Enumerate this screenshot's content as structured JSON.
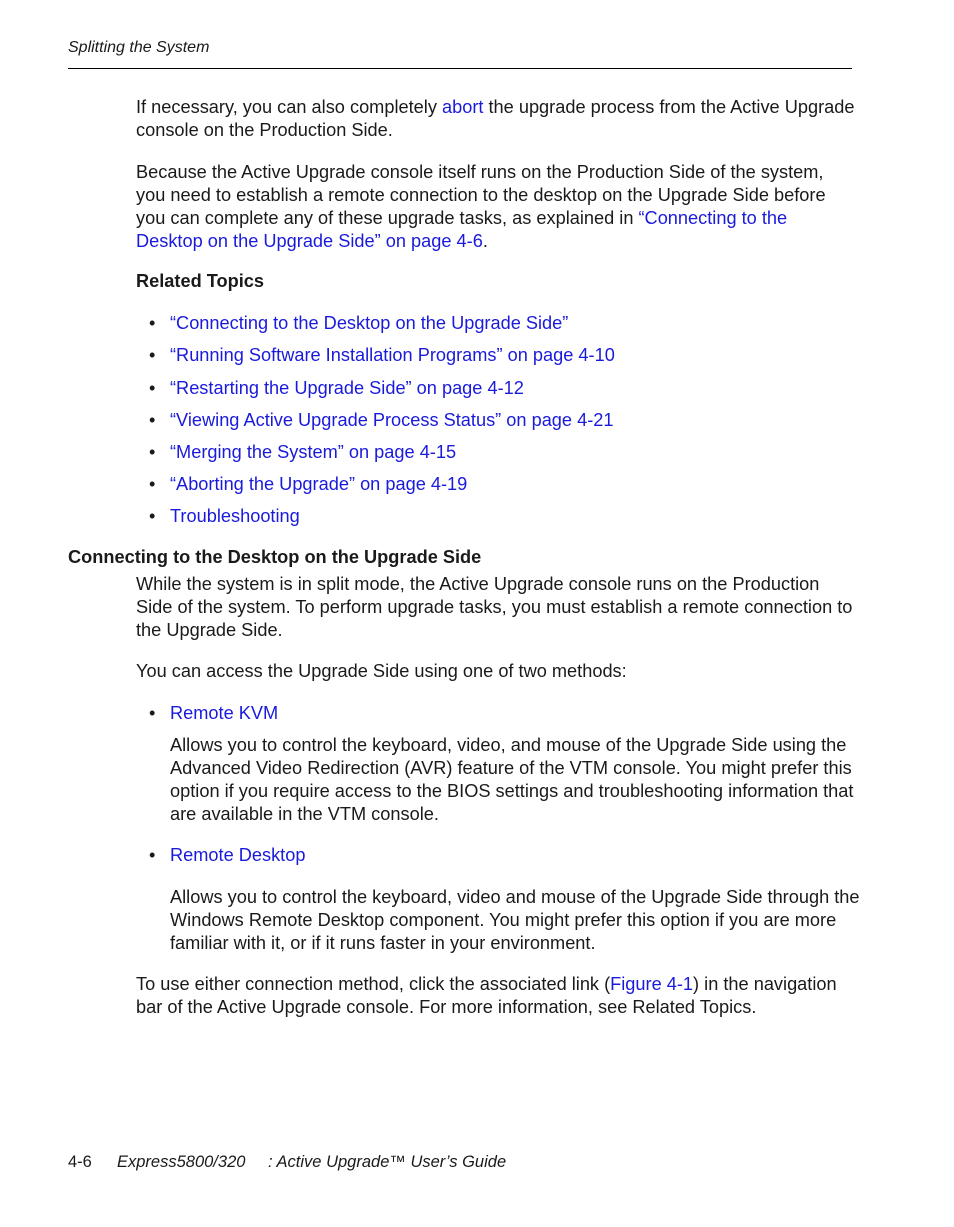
{
  "header": {
    "running_title": "Splitting the System"
  },
  "intro": {
    "p1_before": "If necessary, you can also completely ",
    "p1_link": "abort",
    "p1_after": " the upgrade process from the Active Upgrade console on the Production Side.",
    "p2_before": "Because the Active Upgrade console itself runs on the Production Side of the system, you need to establish a remote connection to the desktop on the Upgrade Side before you can complete any of these upgrade tasks, as explained in ",
    "p2_link": "“Connecting to the Desktop on the Upgrade Side” on page 4-6",
    "p2_after": "."
  },
  "related_topics": {
    "heading": "Related Topics",
    "items": [
      "“Connecting to the Desktop on the Upgrade Side”",
      "“Running Software Installation Programs” on page 4-10",
      "“Restarting the Upgrade Side” on page 4-12",
      "“Viewing Active Upgrade Process Status” on page 4-21",
      "“Merging the System” on page 4-15",
      "“Aborting the Upgrade” on page 4-19",
      "Troubleshooting"
    ]
  },
  "section": {
    "heading": "Connecting to the Desktop on the Upgrade Side",
    "p1": "While the system is in split mode, the Active Upgrade console runs on the Production Side of the system. To perform upgrade tasks, you must establish a remote connection to the Upgrade Side.",
    "p2": "You can access the Upgrade Side using one of two methods:",
    "methods": [
      {
        "label": "Remote KVM",
        "description": "Allows you to control the keyboard, video, and mouse of the Upgrade Side using the Advanced Video Redirection (AVR) feature of the VTM console. You might prefer this option if you require access to the BIOS settings and troubleshooting information that are available in the VTM console."
      },
      {
        "label": "Remote Desktop",
        "description": "Allows you to control the keyboard, video and mouse of the Upgrade Side through the Windows Remote Desktop component. You might prefer this option if you are more familiar with it, or if it runs faster in your environment."
      }
    ],
    "p3_before": "To use either connection method, click the associated link (",
    "p3_link": "Figure 4-1",
    "p3_after": ") in the navigation bar of the Active Upgrade console. For more information, see Related Topics."
  },
  "footer": {
    "page_number": "4-6",
    "product": "Express5800/320",
    "guide_title": ": Active Upgrade™ User’s Guide"
  },
  "bullet_glyph": "•",
  "link_color": "#1a1adc"
}
